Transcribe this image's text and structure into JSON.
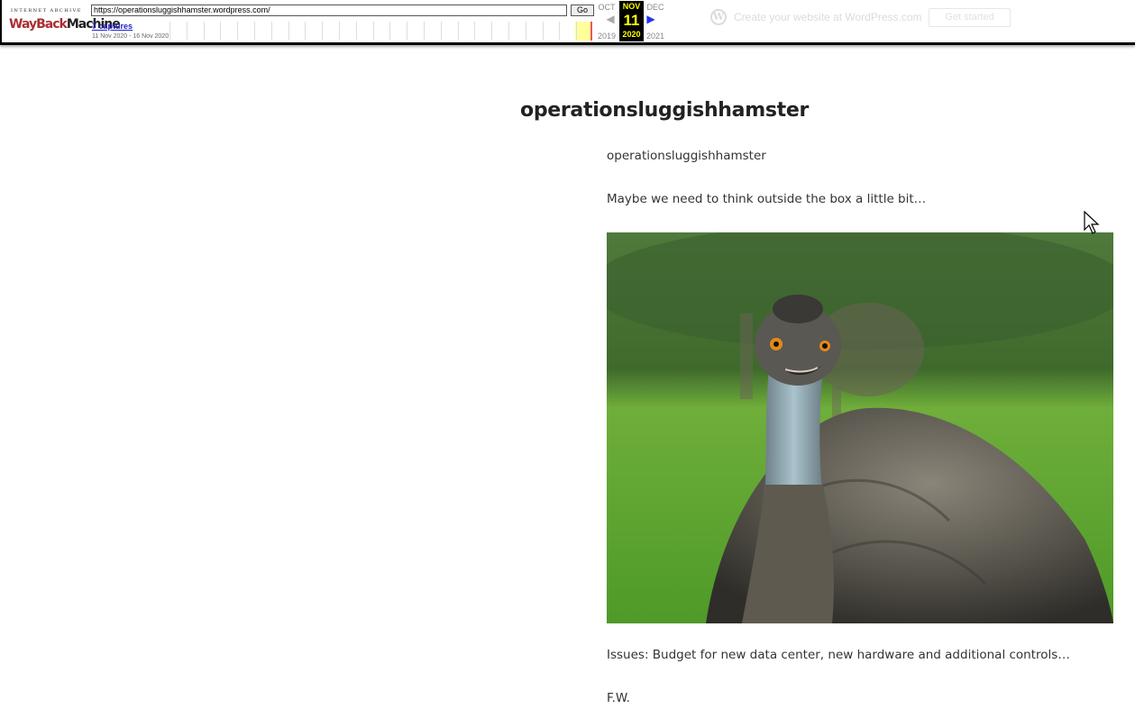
{
  "toolbar": {
    "logo_top": "INTERNET ARCHIVE",
    "logo_way": "WayBack",
    "logo_machine": "Machine",
    "url": "https://operationsluggishhamster.wordpress.com/",
    "go_label": "Go",
    "captures_link": "7 captures",
    "capture_range": "11 Nov 2020 - 16 Nov 2020",
    "calendar": {
      "prev_month": "OCT",
      "current_month": "NOV",
      "next_month": "DEC",
      "current_day": "11",
      "prev_year": "2019",
      "current_year": "2020",
      "next_year": "2021"
    }
  },
  "wp_banner": {
    "icon": "wordpress-logo-icon",
    "text": "Create your website at WordPress.com",
    "button": "Get started"
  },
  "page": {
    "site_title": "operationsluggishhamster",
    "paragraphs": [
      "operationsluggishhamster",
      "Maybe we need to think outside the box a little bit…",
      "Issues: Budget for new data center, new hardware and additional controls…",
      "F.W."
    ],
    "image_subject": "emu-photo"
  },
  "colors": {
    "wayback_red": "#ab2e33",
    "calendar_highlight": "#ffff00",
    "next_arrow": "#2233ee"
  }
}
